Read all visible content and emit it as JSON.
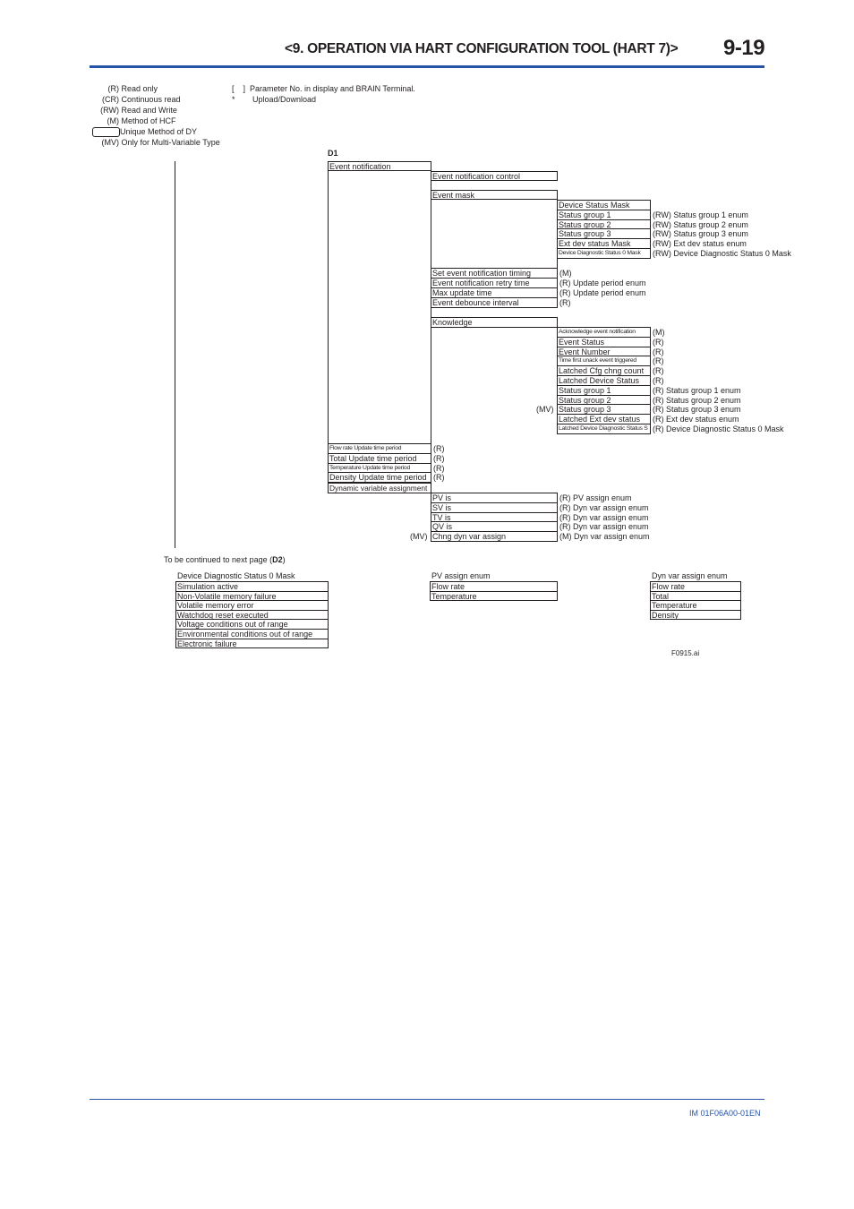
{
  "header": {
    "title": "<9.  OPERATION VIA HART CONFIGURATION TOOL (HART 7)>",
    "page_number": "9-19",
    "accent_color": "#2553a7"
  },
  "legend": {
    "left": [
      {
        "key": "(R)",
        "label": "Read only"
      },
      {
        "key": "(CR)",
        "label": "Continuous read"
      },
      {
        "key": "(RW)",
        "label": "Read and Write"
      },
      {
        "key": "(M)",
        "label": "Method of HCF"
      },
      {
        "key": "oval-icon",
        "label": "Unique Method of DY"
      },
      {
        "key": "(MV)",
        "label": "Only for Multi-Variable Type"
      }
    ],
    "right": [
      {
        "key": "[    ]",
        "label": "Parameter No. in display and BRAIN Terminal."
      },
      {
        "key": "*",
        "label": "Upload/Download"
      }
    ]
  },
  "diagram": {
    "section_label": "D1",
    "root": "Event notification",
    "level1": {
      "event_notification_control": "Event notification control",
      "event_mask": "Event mask",
      "set_timing": {
        "label": "Set event notification timing",
        "note": "(M)"
      },
      "retry_time": {
        "label": "Event notification retry time",
        "note": "(R) Update period enum"
      },
      "max_update": {
        "label": "Max update time",
        "note": "(R) Update period enum"
      },
      "debounce": {
        "label": "Event debounce interval",
        "note": "(R)"
      },
      "knowledge": "Knowledge"
    },
    "event_mask_items": [
      {
        "label": "Device Status Mask",
        "note": ""
      },
      {
        "label": "Status group 1",
        "note": "(RW) Status group 1 enum"
      },
      {
        "label": "Status group 2",
        "note": "(RW) Status group 2 enum"
      },
      {
        "label": "Status group 3",
        "note": "(RW) Status group 3 enum"
      },
      {
        "label": "Ext dev status Mask",
        "note": "(RW) Ext dev status enum"
      },
      {
        "label": "Device Diagnostic Status 0 Mask",
        "note": "(RW) Device Diagnostic Status 0 Mask"
      }
    ],
    "knowledge_items": [
      {
        "label": "Acknowledge event notification",
        "note": "(M)",
        "prefix": ""
      },
      {
        "label": "Event Status",
        "note": "(R)",
        "prefix": ""
      },
      {
        "label": "Event Number",
        "note": "(R)",
        "prefix": ""
      },
      {
        "label": "Time first unack event triggered",
        "note": "(R)",
        "prefix": ""
      },
      {
        "label": "Latched Cfg chng count",
        "note": "(R)",
        "prefix": ""
      },
      {
        "label": "Latched Device Status",
        "note": "(R)",
        "prefix": ""
      },
      {
        "label": "Status group 1",
        "note": "(R) Status group 1 enum",
        "prefix": ""
      },
      {
        "label": "Status group 2",
        "note": "(R) Status group 2 enum",
        "prefix": ""
      },
      {
        "label": "Status group 3",
        "note": "(R) Status group 3 enum",
        "prefix": "(MV)"
      },
      {
        "label": "Latched Ext dev status",
        "note": "(R) Ext dev status enum",
        "prefix": ""
      },
      {
        "label": "Latched Device Diagnostic Status S",
        "note": "(R) Device Diagnostic Status 0 Mask",
        "prefix": ""
      }
    ],
    "update_periods": [
      {
        "label": "Flow rate Update time period",
        "note": "(R)"
      },
      {
        "label": "Total Update time period",
        "note": "(R)"
      },
      {
        "label": "Temperature Update time period",
        "note": "(R)"
      },
      {
        "label": "Density Update time period",
        "note": "(R)"
      }
    ],
    "dynamic_variable_assignment": "Dynamic variable assignment",
    "dva_items": [
      {
        "label": "PV is",
        "note": "(R) PV assign enum",
        "prefix": ""
      },
      {
        "label": "SV is",
        "note": "(R) Dyn var assign enum",
        "prefix": ""
      },
      {
        "label": "TV is",
        "note": "(R) Dyn var assign enum",
        "prefix": ""
      },
      {
        "label": "QV is",
        "note": "(R) Dyn var assign enum",
        "prefix": ""
      },
      {
        "label": "Chng dyn var assign",
        "note": "(M) Dyn var assign enum",
        "prefix": "(MV)"
      }
    ],
    "continued": {
      "text": "To be continued to next page (",
      "ref": "D2",
      "close": ")"
    }
  },
  "enums": {
    "device_diag": {
      "title": "Device Diagnostic Status 0 Mask",
      "items": [
        "Simulation active",
        "Non-Volatile memory failure",
        "Volatile memory error",
        "Watchdog reset executed",
        "Voltage conditions out of range",
        "Environmental conditions out of range",
        "Electronic failure"
      ]
    },
    "pv_assign": {
      "title": "PV assign enum",
      "items": [
        "Flow rate",
        "Temperature"
      ]
    },
    "dyn_var_assign": {
      "title": "Dyn var assign enum",
      "items": [
        "Flow rate",
        "Total",
        "Temperature",
        "Density"
      ]
    }
  },
  "figure_id": "F0915.ai",
  "footer": {
    "doc_id": "IM 01F06A00-01EN"
  }
}
